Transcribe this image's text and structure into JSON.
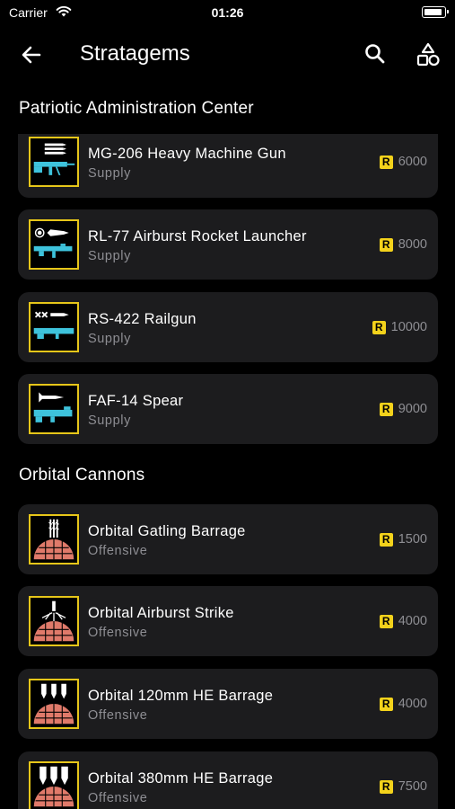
{
  "status_bar": {
    "carrier": "Carrier",
    "time": "01:26"
  },
  "nav": {
    "title": "Stratagems",
    "back_icon": "arrow-left-icon",
    "search_icon": "search-icon",
    "filter_icon": "shapes-icon"
  },
  "sections": [
    {
      "title": "Patriotic Administration Center",
      "items": [
        {
          "name": "MG-206 Heavy Machine Gun",
          "type": "Supply",
          "currency": "R",
          "price": "6000",
          "icon": "machine-gun-icon"
        },
        {
          "name": "RL-77 Airburst Rocket Launcher",
          "type": "Supply",
          "currency": "R",
          "price": "8000",
          "icon": "rocket-launcher-icon"
        },
        {
          "name": "RS-422 Railgun",
          "type": "Supply",
          "currency": "R",
          "price": "10000",
          "icon": "railgun-icon"
        },
        {
          "name": "FAF-14 Spear",
          "type": "Supply",
          "currency": "R",
          "price": "9000",
          "icon": "spear-launcher-icon"
        }
      ]
    },
    {
      "title": "Orbital Cannons",
      "items": [
        {
          "name": "Orbital Gatling Barrage",
          "type": "Offensive",
          "currency": "R",
          "price": "1500",
          "icon": "orbital-gatling-icon"
        },
        {
          "name": "Orbital Airburst Strike",
          "type": "Offensive",
          "currency": "R",
          "price": "4000",
          "icon": "orbital-airburst-icon"
        },
        {
          "name": "Orbital 120mm HE Barrage",
          "type": "Offensive",
          "currency": "R",
          "price": "4000",
          "icon": "orbital-120mm-icon"
        },
        {
          "name": "Orbital 380mm HE Barrage",
          "type": "Offensive",
          "currency": "R",
          "price": "7500",
          "icon": "orbital-380mm-icon"
        }
      ]
    }
  ],
  "colors": {
    "background": "#000000",
    "card": "#1c1c1e",
    "accent": "#f3d21b",
    "icon_border": "#e6c619",
    "subtext": "#8e8e93",
    "weapon": "#3ec3dc",
    "dome": "#e07a6a"
  }
}
